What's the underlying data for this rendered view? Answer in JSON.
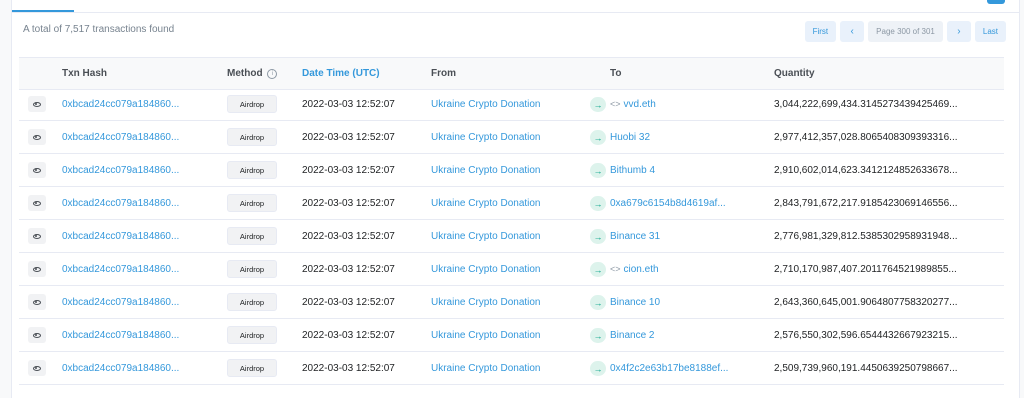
{
  "summary": {
    "total_text": "A total of 7,517 transactions found"
  },
  "pagination": {
    "first": "First",
    "prev": "‹",
    "page": "Page 300 of 301",
    "next": "›",
    "last": "Last"
  },
  "columns": {
    "hash": "Txn Hash",
    "method": "Method",
    "date": "Date Time (UTC)",
    "from": "From",
    "to": "To",
    "quantity": "Quantity"
  },
  "icons": {
    "view": "eye-icon",
    "direction": "arrow-right-icon",
    "contract": "contract-code-icon",
    "info": "info-icon"
  },
  "colors": {
    "link": "#3498db",
    "direction_bg": "#ddf3ec",
    "direction_fg": "#00a186"
  },
  "rows": [
    {
      "hash": "0xbcad24cc079a184860...",
      "method": "Airdrop",
      "date": "2022-03-03 12:52:07",
      "from": "Ukraine Crypto Donation",
      "to": "vvd.eth",
      "to_contract": true,
      "quantity": "3,044,222,699,434.3145273439425469..."
    },
    {
      "hash": "0xbcad24cc079a184860...",
      "method": "Airdrop",
      "date": "2022-03-03 12:52:07",
      "from": "Ukraine Crypto Donation",
      "to": "Huobi 32",
      "to_contract": false,
      "quantity": "2,977,412,357,028.8065408309393316..."
    },
    {
      "hash": "0xbcad24cc079a184860...",
      "method": "Airdrop",
      "date": "2022-03-03 12:52:07",
      "from": "Ukraine Crypto Donation",
      "to": "Bithumb 4",
      "to_contract": false,
      "quantity": "2,910,602,014,623.3412124852633678..."
    },
    {
      "hash": "0xbcad24cc079a184860...",
      "method": "Airdrop",
      "date": "2022-03-03 12:52:07",
      "from": "Ukraine Crypto Donation",
      "to": "0xa679c6154b8d4619af...",
      "to_contract": false,
      "quantity": "2,843,791,672,217.9185423069146556..."
    },
    {
      "hash": "0xbcad24cc079a184860...",
      "method": "Airdrop",
      "date": "2022-03-03 12:52:07",
      "from": "Ukraine Crypto Donation",
      "to": "Binance 31",
      "to_contract": false,
      "quantity": "2,776,981,329,812.5385302958931948..."
    },
    {
      "hash": "0xbcad24cc079a184860...",
      "method": "Airdrop",
      "date": "2022-03-03 12:52:07",
      "from": "Ukraine Crypto Donation",
      "to": "cion.eth",
      "to_contract": true,
      "quantity": "2,710,170,987,407.2011764521989855..."
    },
    {
      "hash": "0xbcad24cc079a184860...",
      "method": "Airdrop",
      "date": "2022-03-03 12:52:07",
      "from": "Ukraine Crypto Donation",
      "to": "Binance 10",
      "to_contract": false,
      "quantity": "2,643,360,645,001.9064807758320277..."
    },
    {
      "hash": "0xbcad24cc079a184860...",
      "method": "Airdrop",
      "date": "2022-03-03 12:52:07",
      "from": "Ukraine Crypto Donation",
      "to": "Binance 2",
      "to_contract": false,
      "quantity": "2,576,550,302,596.6544432667923215..."
    },
    {
      "hash": "0xbcad24cc079a184860...",
      "method": "Airdrop",
      "date": "2022-03-03 12:52:07",
      "from": "Ukraine Crypto Donation",
      "to": "0x4f2c2e63b17be8188ef...",
      "to_contract": false,
      "quantity": "2,509,739,960,191.4450639250798667..."
    }
  ]
}
